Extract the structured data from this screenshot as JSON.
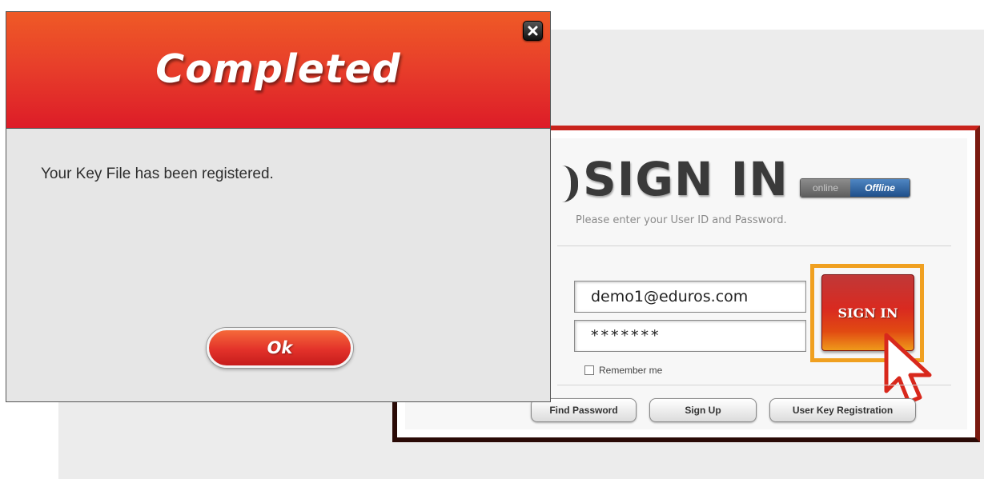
{
  "signin": {
    "title": "SIGN IN",
    "subtitle": "Please enter your User ID and Password.",
    "status_toggle": {
      "online_label": "online",
      "offline_label": "Offline",
      "selected": "Offline"
    },
    "user_id_value": "demo1@eduros.com",
    "password_value": "*******",
    "remember_label": "Remember me",
    "remember_checked": false,
    "signin_button_label": "SIGN IN",
    "find_password_label": "Find Password",
    "sign_up_label": "Sign Up",
    "user_key_registration_label": "User Key Registration",
    "highlight_color": "#f0a020"
  },
  "dialog": {
    "title": "Completed",
    "message": "Your Key File has been registered.",
    "ok_label": "Ok",
    "close_icon": "close-icon",
    "header_color": "#e03a28"
  },
  "overlay": {
    "cursor_icon": "pointer-arrow-icon"
  }
}
